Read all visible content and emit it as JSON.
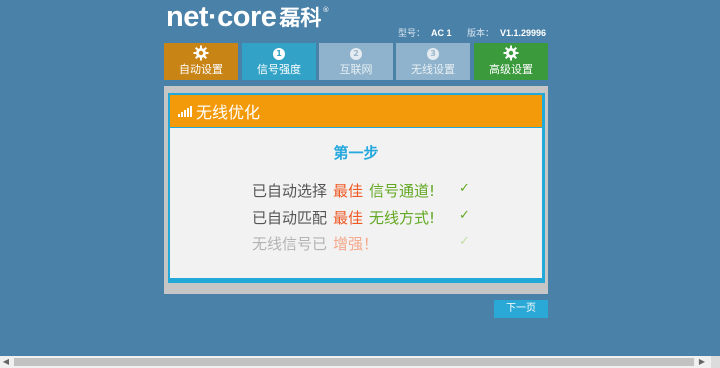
{
  "brand": {
    "name_en": "net·core",
    "name_cn": "磊科",
    "reg": "®"
  },
  "device": {
    "model_label": "型号：",
    "model": "AC 1",
    "version_label": "版本：",
    "version": "V1.1.29996"
  },
  "tabs": [
    {
      "label": "自动设置",
      "icon": "gear-icon",
      "color": "#c98416",
      "state": "inactive-special"
    },
    {
      "label": "信号强度",
      "num": "1",
      "color": "#32a3c7",
      "state": "active"
    },
    {
      "label": "互联网",
      "num": "2",
      "color": "#8fb3cc",
      "state": "inactive"
    },
    {
      "label": "无线设置",
      "num": "3",
      "color": "#8fb3cc",
      "state": "inactive"
    },
    {
      "label": "高级设置",
      "icon": "gear-icon",
      "color": "#3a9a3c",
      "state": "inactive-special"
    }
  ],
  "panel": {
    "title": "无线优化",
    "step": "第一步",
    "rows": [
      {
        "prefix": "已自动选择",
        "highlight": "最佳",
        "suffix": "信号通道!",
        "check": "✓"
      },
      {
        "prefix": "已自动匹配",
        "highlight": "最佳",
        "suffix": "无线方式!",
        "check": "✓"
      },
      {
        "prefix": "无线信号已",
        "highlight": "增强！",
        "check": "✓"
      }
    ]
  },
  "buttons": {
    "next": "下一页"
  },
  "scrollbar": {
    "left_arrow": "◀",
    "right_arrow": "▶"
  },
  "colors": {
    "background": "#4a81a8",
    "header": "#f39a0a",
    "accent": "#25a8dd",
    "orange_text": "#f05a24",
    "green_text": "#62a822"
  }
}
